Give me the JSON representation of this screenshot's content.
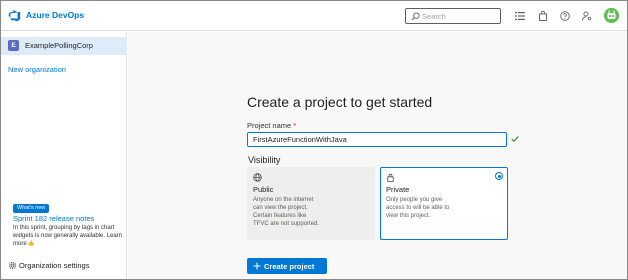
{
  "header": {
    "app_title": "Azure DevOps",
    "search_placeholder": "Search",
    "icons": [
      "devops-logo-icon",
      "list-settings-icon",
      "shopping-bag-icon",
      "help-icon",
      "user-settings-icon",
      "avatar"
    ]
  },
  "sidebar": {
    "org_badge": "E",
    "org_name": "ExamplePollingCorp",
    "new_org": "New organization",
    "whats_new": "What's new",
    "sprint_link": "Sprint 182 release notes",
    "sprint_desc": "In this sprint, grouping by tags in chart widgets is now generally available.",
    "learn_more": "Learn more",
    "org_settings": "Organization settings"
  },
  "main": {
    "title": "Create a project to get started",
    "project_name_label": "Project name",
    "required_mark": "*",
    "project_name_value": "FirstAzureFunctionWithJava",
    "visibility_label": "Visibility",
    "visibility_options": [
      {
        "title": "Public",
        "description": "Anyone on the internet can view the project. Certain features like TFVC are not supported.",
        "selected": false
      },
      {
        "title": "Private",
        "description": "Only people you give access to will be able to view this project.",
        "selected": true
      }
    ],
    "create_button": "Create project"
  },
  "colors": {
    "accent": "#0078d4",
    "selected_bg": "#deecf9",
    "main_bg": "#f8f8f8"
  }
}
